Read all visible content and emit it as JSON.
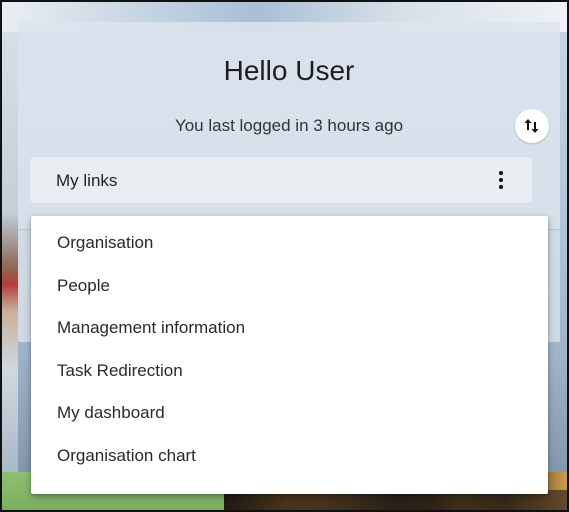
{
  "header": {
    "greeting": "Hello User",
    "last_login": "You last logged in 3 hours ago"
  },
  "sort_button": {
    "icon": "sort-arrows-icon"
  },
  "links_bar": {
    "label": "My links",
    "menu_icon": "more-vertical-icon"
  },
  "menu": {
    "items": [
      {
        "label": "Organisation"
      },
      {
        "label": "People"
      },
      {
        "label": "Management information"
      },
      {
        "label": "Task Redirection"
      },
      {
        "label": "My dashboard"
      },
      {
        "label": "Organisation chart"
      }
    ]
  },
  "colors": {
    "card_bg": "#dce4ed",
    "menu_bg": "#ffffff",
    "text": "#222222"
  }
}
